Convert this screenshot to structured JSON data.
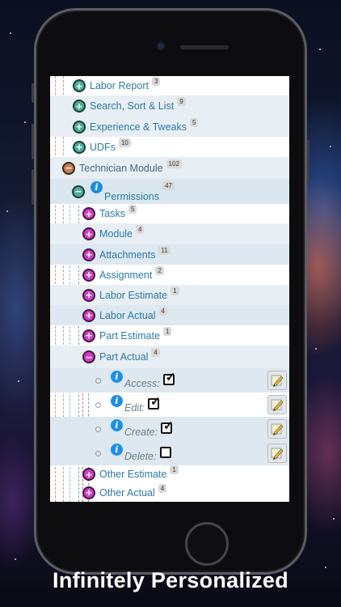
{
  "tree": {
    "items": [
      {
        "label": "Labor Report",
        "count": "3",
        "icon": "plus-circle-icon"
      },
      {
        "label": "Search, Sort & List",
        "count": "9",
        "icon": "plus-circle-icon"
      },
      {
        "label": "Experience & Tweaks",
        "count": "5",
        "icon": "plus-circle-icon"
      },
      {
        "label": "UDFs",
        "count": "10",
        "icon": "plus-circle-icon"
      },
      {
        "label": "Technician Module",
        "count": "102",
        "icon": "minus-circle-icon"
      },
      {
        "label": "Permissions",
        "count": "47",
        "icon": "minus-circle-icon"
      },
      {
        "label": "Tasks",
        "count": "5",
        "icon": "plus-circle-icon"
      },
      {
        "label": "Module",
        "count": "4",
        "icon": "plus-circle-icon"
      },
      {
        "label": "Attachments",
        "count": "11",
        "icon": "plus-circle-icon"
      },
      {
        "label": "Assignment",
        "count": "2",
        "icon": "plus-circle-icon"
      },
      {
        "label": "Labor Estimate",
        "count": "1",
        "icon": "plus-circle-icon"
      },
      {
        "label": "Labor Actual",
        "count": "4",
        "icon": "plus-circle-icon"
      },
      {
        "label": "Part Estimate",
        "count": "1",
        "icon": "plus-circle-icon"
      },
      {
        "label": "Part Actual",
        "count": "4",
        "icon": "minus-circle-icon"
      },
      {
        "label": "Other Estimate",
        "count": "1",
        "icon": "plus-circle-icon"
      },
      {
        "label": "Other Actual",
        "count": "4",
        "icon": "plus-circle-icon"
      }
    ],
    "permissions": [
      {
        "label": "Access:",
        "checked": true
      },
      {
        "label": "Edit:",
        "checked": true
      },
      {
        "label": "Create:",
        "checked": true
      },
      {
        "label": "Delete:",
        "checked": false
      }
    ]
  },
  "colors": {
    "expand_icon": "#4cae9c",
    "module_icon": "#c47f52",
    "sub_icon": "#d23ec8",
    "info_icon": "#1e8ee8",
    "label": "#2c7aa3"
  },
  "footer": {
    "tagline": "Infinitely Personalized"
  }
}
